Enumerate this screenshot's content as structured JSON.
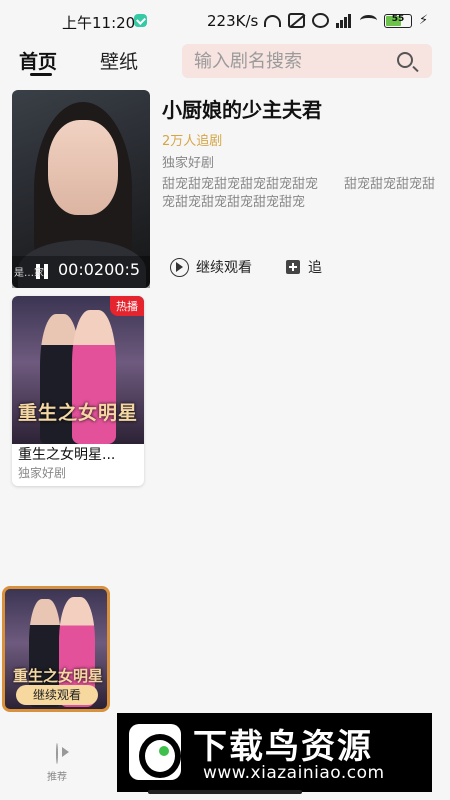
{
  "status_bar": {
    "time": "上午11:20",
    "net_speed": "223K/s",
    "battery": "55"
  },
  "header": {
    "tab_home": "首页",
    "tab_wallpaper": "壁纸",
    "search_placeholder": "输入剧名搜索"
  },
  "featured": {
    "title": "小厨娘的少主夫君",
    "followers": "2万人追剧",
    "tag": "独家好剧",
    "description": "甜宠甜宠甜宠甜宠甜宠甜宠　　甜宠甜宠甜宠甜宠甜宠甜宠甜宠甜宠甜宠",
    "video_time": "00:0200:5",
    "video_subtitle": "是…家",
    "continue_label": "继续观看",
    "follow_label": "追"
  },
  "cards": [
    {
      "title": "重生之女明星...",
      "tag": "独家好剧",
      "badge": "热播",
      "poster_text": "重生之女明星"
    }
  ],
  "mini_player": {
    "poster_text": "重生之女明星",
    "button_label": "继续观看"
  },
  "bottom_nav": {
    "recommend_label": "推荐"
  },
  "watermark": {
    "title": "下载鸟资源",
    "url": "www.xiazainiao.com"
  }
}
